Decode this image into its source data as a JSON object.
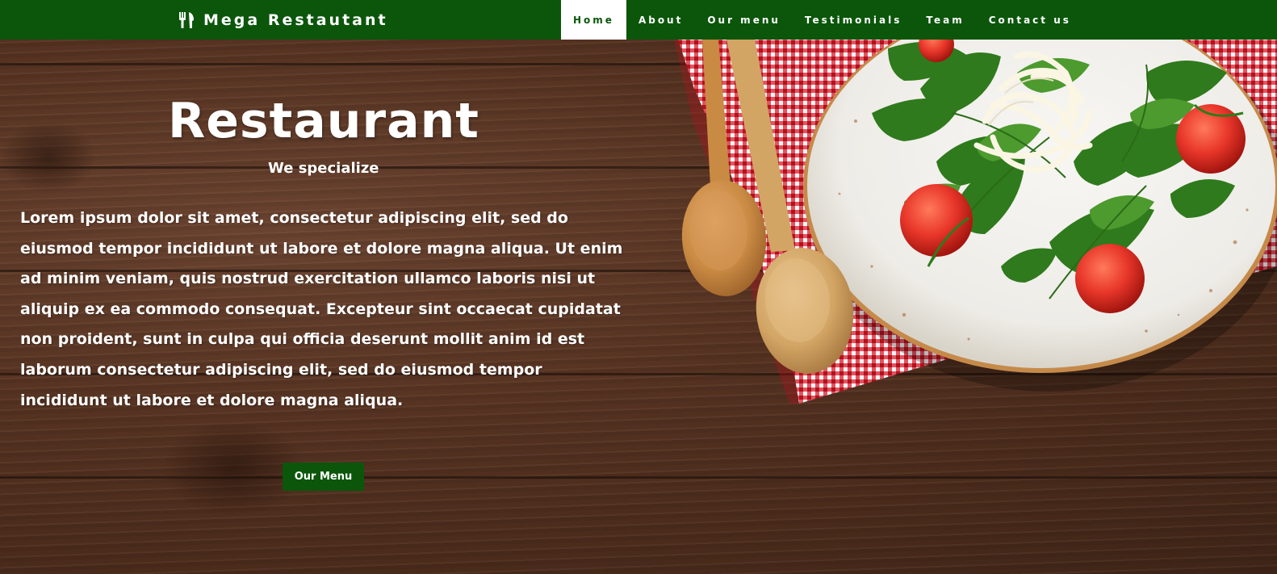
{
  "navbar": {
    "brand_icon": "fork-knife-icon",
    "brand_label": "Mega Restautant",
    "items": [
      {
        "label": "Home",
        "active": true
      },
      {
        "label": "About",
        "active": false
      },
      {
        "label": "Our menu",
        "active": false
      },
      {
        "label": "Testimonials",
        "active": false
      },
      {
        "label": "Team",
        "active": false
      },
      {
        "label": "Contact us",
        "active": false
      }
    ]
  },
  "hero": {
    "title": "Restaurant",
    "subtitle": "We specialize",
    "body": "Lorem ipsum dolor sit amet, consectetur adipiscing elit, sed do eiusmod tempor incididunt ut labore et dolore magna aliqua. Ut enim ad minim veniam, quis nostrud exercitation ullamco laboris nisi ut aliquip ex ea commodo consequat. Excepteur sint occaecat cupidatat non proident, sunt in culpa qui officia deserunt mollit anim id est laborum consectetur adipiscing elit, sed do eiusmod tempor incididunt ut labore et dolore magna aliqua.",
    "button_label": "Our Menu"
  },
  "colors": {
    "brand_green": "#0b560b",
    "text": "#ffffff",
    "wood": "#553221"
  }
}
